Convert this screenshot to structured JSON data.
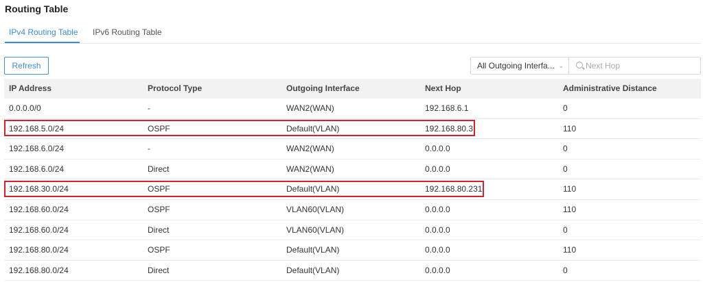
{
  "page": {
    "title": "Routing Table"
  },
  "tabs": [
    {
      "label": "IPv4 Routing Table",
      "active": true
    },
    {
      "label": "IPv6 Routing Table",
      "active": false
    }
  ],
  "toolbar": {
    "refresh_label": "Refresh",
    "interface_filter": "All Outgoing Interfa...",
    "next_hop_placeholder": "Next Hop"
  },
  "table": {
    "headers": [
      "IP Address",
      "Protocol Type",
      "Outgoing Interface",
      "Next Hop",
      "Administrative Distance"
    ],
    "rows": [
      [
        "0.0.0.0/0",
        "-",
        "WAN2(WAN)",
        "192.168.6.1",
        "0"
      ],
      [
        "192.168.5.0/24",
        "OSPF",
        "Default(VLAN)",
        "192.168.80.3",
        "110"
      ],
      [
        "192.168.6.0/24",
        "-",
        "WAN2(WAN)",
        "0.0.0.0",
        "0"
      ],
      [
        "192.168.6.0/24",
        "Direct",
        "WAN2(WAN)",
        "0.0.0.0",
        "0"
      ],
      [
        "192.168.30.0/24",
        "OSPF",
        "Default(VLAN)",
        "192.168.80.231",
        "110"
      ],
      [
        "192.168.60.0/24",
        "OSPF",
        "VLAN60(VLAN)",
        "0.0.0.0",
        "110"
      ],
      [
        "192.168.60.0/24",
        "Direct",
        "VLAN60(VLAN)",
        "0.0.0.0",
        "0"
      ],
      [
        "192.168.80.0/24",
        "OSPF",
        "Default(VLAN)",
        "0.0.0.0",
        "110"
      ],
      [
        "192.168.80.0/24",
        "Direct",
        "Default(VLAN)",
        "0.0.0.0",
        "0"
      ]
    ]
  },
  "colors": {
    "accent": "#3d8cd6",
    "highlight": "#d8202a",
    "header_bg": "#f2f2f2"
  }
}
